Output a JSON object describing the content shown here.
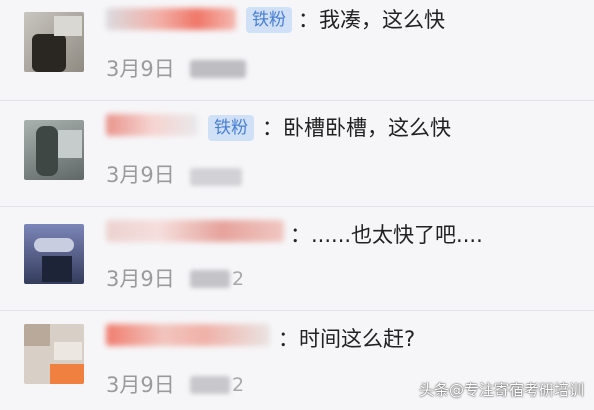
{
  "comments": [
    {
      "badge": "铁粉",
      "text": "：我凑，这么快",
      "date": "3月9日",
      "time_visible": ""
    },
    {
      "badge": "铁粉",
      "text": "：卧槽卧槽，这么快",
      "date": "3月9日",
      "time_visible": ""
    },
    {
      "badge": "",
      "text": "：......也太快了吧....",
      "date": "3月9日",
      "time_visible": "2"
    },
    {
      "badge": "",
      "text": "：时间这么赶?",
      "date": "3月9日",
      "time_visible": "2"
    }
  ],
  "watermark": "头条@专注寄宿考研培训",
  "colors": {
    "background": "#f6f6f8",
    "badge_bg": "#cfe0f7",
    "badge_text": "#4a7fd1",
    "date_text": "#9a9a9a"
  },
  "icons": [
    "avatar-image",
    "blurred-username"
  ]
}
